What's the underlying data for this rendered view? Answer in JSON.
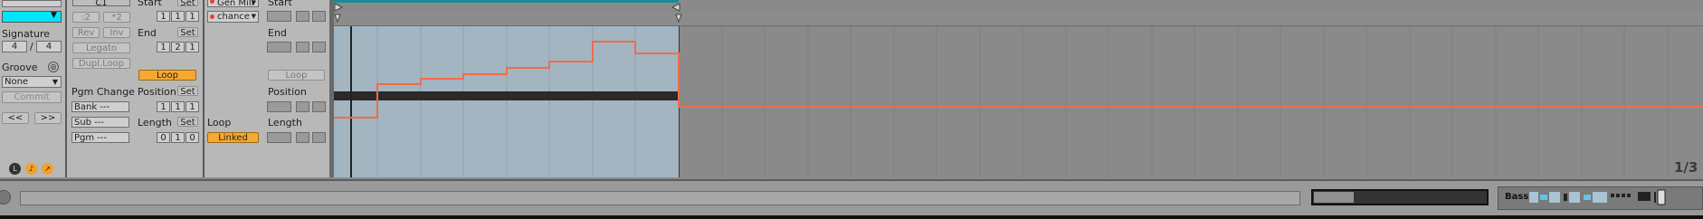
{
  "col1": {
    "signature_label": "Signature",
    "sig_num": "4",
    "sig_sep": "/",
    "sig_den": "4",
    "groove_label": "Groove",
    "groove_value": "None",
    "commit_label": "Commit",
    "nav_prev": "<<",
    "nav_next": ">>",
    "accent_color": "#00e6ff"
  },
  "col2": {
    "note_value": "C1",
    "half_label": ":2",
    "double_label": "*2",
    "rev_label": "Rev",
    "inv_label": "Inv",
    "legato_label": "Legato",
    "dupl_loop_label": "Dupl.Loop",
    "pgm_change_label": "Pgm Change",
    "bank_label": "Bank ---",
    "sub_label": "Sub ---",
    "pgm_label": "Pgm ---"
  },
  "col3": {
    "start_label": "Start",
    "set_label": "Set",
    "start_values": [
      "1",
      "1",
      "1"
    ],
    "end_label": "End",
    "end_values": [
      "1",
      "2",
      "1"
    ],
    "loop_label": "Loop",
    "position_label": "Position",
    "position_values": [
      "1",
      "1",
      "1"
    ],
    "length_label": "Length",
    "length_values": [
      "0",
      "1",
      "0"
    ]
  },
  "col4": {
    "device_value": "Gen Mill",
    "param_value": "chance",
    "loop_label": "Loop",
    "linked_label": "Linked"
  },
  "col5": {
    "start_label": "Start",
    "end_label": "End",
    "loop_label": "Loop",
    "position_label": "Position",
    "length_label": "Length"
  },
  "editor": {
    "page_indicator": "1/3",
    "envelope_color": "#f26b4a",
    "loop_region_color": "#a3b5c0"
  },
  "bottom": {
    "track_name": "Bass"
  }
}
